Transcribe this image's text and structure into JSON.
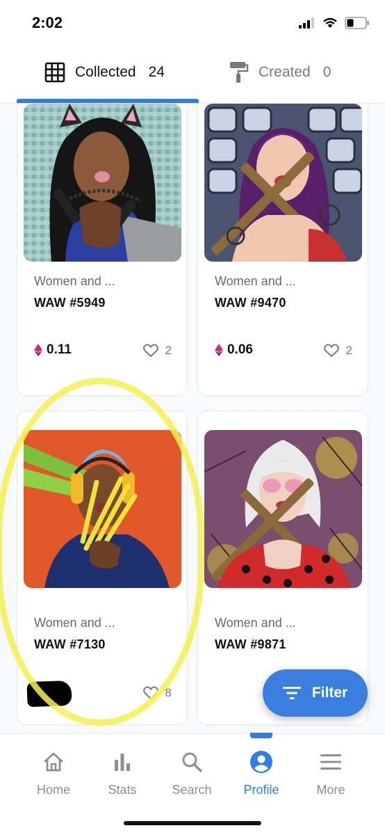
{
  "status_bar": {
    "time": "2:02"
  },
  "tabs": [
    {
      "label": "Collected",
      "count": "24",
      "icon": "grid-icon",
      "selected": true
    },
    {
      "label": "Created",
      "count": "0",
      "icon": "paint-roller-icon",
      "selected": false
    }
  ],
  "cards": [
    {
      "collection": "Women and ...",
      "token": "WAW #5949",
      "price": "0.11",
      "likes": "2"
    },
    {
      "collection": "Women and ...",
      "token": "WAW #9470",
      "price": "0.06",
      "likes": "2"
    },
    {
      "collection": "Women and ...",
      "token": "WAW #7130",
      "price": "",
      "likes": "8"
    },
    {
      "collection": "Women and ...",
      "token": "WAW #9871",
      "price": "",
      "likes": ""
    }
  ],
  "filter_button": {
    "label": "Filter"
  },
  "bottom_nav": [
    {
      "label": "Home",
      "icon": "home-icon"
    },
    {
      "label": "Stats",
      "icon": "bar-chart-icon"
    },
    {
      "label": "Search",
      "icon": "search-icon"
    },
    {
      "label": "Profile",
      "icon": "profile-icon",
      "active": true
    },
    {
      "label": "More",
      "icon": "menu-icon"
    }
  ],
  "colors": {
    "accent": "#2f7de1",
    "filter": "#3b7ee0",
    "eth": "#c2337a",
    "highlight": "#f5f050"
  }
}
